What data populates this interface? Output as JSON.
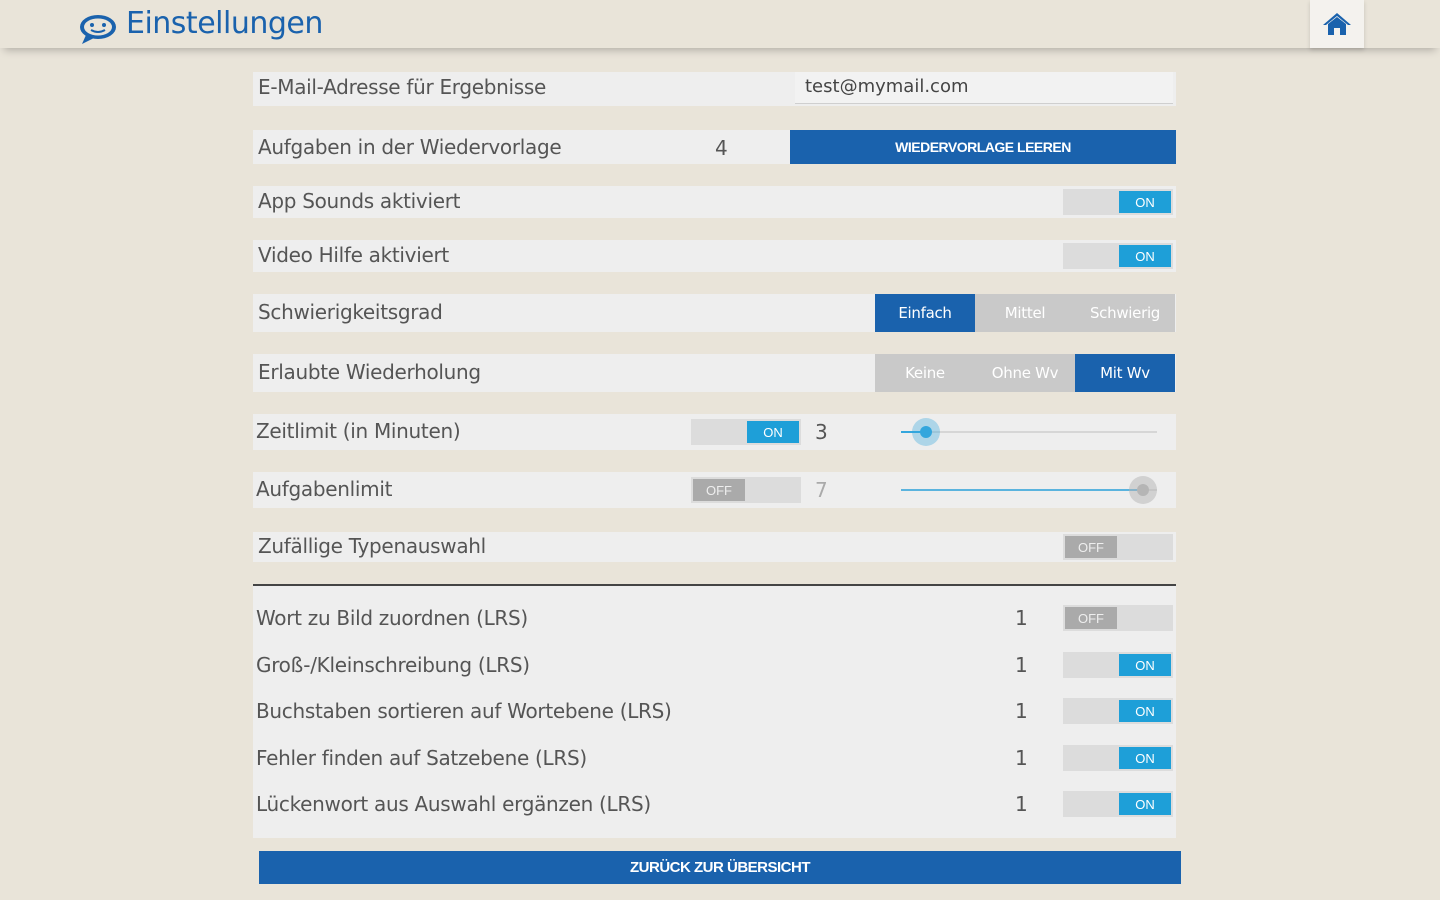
{
  "header": {
    "title": "Einstellungen",
    "logo_icon": "speech-bubble-face-icon",
    "home_icon": "home-icon"
  },
  "settings": {
    "email": {
      "label": "E-Mail-Adresse für Ergebnisse",
      "value": "test@mymail.com"
    },
    "resubmission": {
      "label": "Aufgaben in der Wiedervorlage",
      "count": "4",
      "button": "WIEDERVORLAGE LEEREN"
    },
    "app_sounds": {
      "label": "App Sounds aktiviert",
      "toggle": "ON"
    },
    "video_help": {
      "label": "Video Hilfe aktiviert",
      "toggle": "ON"
    },
    "difficulty": {
      "label": "Schwierigkeitsgrad",
      "options": [
        "Einfach",
        "Mittel",
        "Schwierig"
      ],
      "selected": "Einfach"
    },
    "repetition": {
      "label": "Erlaubte Wiederholung",
      "options": [
        "Keine",
        "Ohne Wv",
        "Mit Wv"
      ],
      "selected": "Mit Wv"
    },
    "time_limit": {
      "label": "Zeitlimit (in Minuten)",
      "toggle": "ON",
      "value": "3",
      "slider_fraction": 0.05
    },
    "task_limit": {
      "label": "Aufgabenlimit",
      "toggle": "OFF",
      "value": "7",
      "slider_fraction": 1.0
    },
    "random_types": {
      "label": "Zufällige Typenauswahl",
      "toggle": "OFF"
    }
  },
  "task_types": [
    {
      "label": "Wort zu Bild zuordnen (LRS)",
      "count": "1",
      "toggle": "OFF"
    },
    {
      "label": "Groß-/Kleinschreibung (LRS)",
      "count": "1",
      "toggle": "ON"
    },
    {
      "label": "Buchstaben sortieren auf Wortebene (LRS)",
      "count": "1",
      "toggle": "ON"
    },
    {
      "label": "Fehler finden auf Satzebene (LRS)",
      "count": "1",
      "toggle": "ON"
    },
    {
      "label": "Lückenwort aus Auswahl ergänzen (LRS)",
      "count": "1",
      "toggle": "ON"
    }
  ],
  "footer": {
    "back_button": "ZURÜCK ZUR ÜBERSICHT"
  },
  "colors": {
    "accent": "#1a62ad",
    "toggle_on": "#1e9fd8",
    "background": "#e9e4d9"
  }
}
